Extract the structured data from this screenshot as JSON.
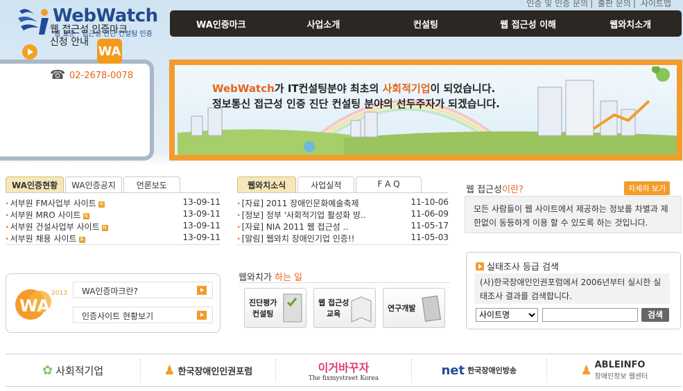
{
  "util": {
    "links": [
      "인증 및 인증 문의",
      "출판 문의",
      "사이트맵"
    ]
  },
  "logo": {
    "name": "WebWatch",
    "sub": "웹 표준 · 접근성 진단 컨설팅 인증"
  },
  "gnb": [
    "WA인증마크",
    "사업소개",
    "컨설팅",
    "웹 접근성 이해",
    "웹와치소개"
  ],
  "cert": {
    "line1": "웹 접근성 인증마크",
    "line2": "신청 안내",
    "mark": "WA",
    "phone": "02-2678-0078"
  },
  "banner": {
    "line1_a": "WebWatch",
    "line1_b": "가 IT컨설팅분야 최초의 ",
    "line1_c": "사회적기업",
    "line1_d": "이 되었습니다.",
    "line2": "정보통신 접근성 인증 진단 컨설팅 분야의 선두주자가 되겠습니다."
  },
  "panel1": {
    "tabs": [
      "WA인증현황",
      "WA인증공지",
      "언론보도"
    ],
    "items": [
      {
        "title": "서부원 FM사업부 사이트",
        "date": "13-09-11"
      },
      {
        "title": "서부원 MRO 사이트",
        "date": "13-09-11"
      },
      {
        "title": "서부원 건설사업부 사이트",
        "date": "13-09-11"
      },
      {
        "title": "서부원 채용 사이트",
        "date": "13-09-11"
      }
    ],
    "badge": "N"
  },
  "panel2": {
    "tabs": [
      "웹와치소식",
      "사업실적",
      "F A Q"
    ],
    "items": [
      {
        "title": "[자료] 2011 장애인문화예술축제",
        "date": "11-10-06"
      },
      {
        "title": "[정보] 정부 '사회적기업 활성화 방..",
        "date": "11-06-09"
      },
      {
        "title": "[자료] NIA 2011 웹 접근성 ..",
        "date": "11-05-17"
      },
      {
        "title": "[알림] 웹와치 장애인기업 인증!!",
        "date": "11-05-03"
      }
    ]
  },
  "acc": {
    "title_a": "웹 접근성",
    "title_b": "이란?",
    "more": "자세히 보기",
    "desc": "모든 사람들이 웹 사이트에서 제공하는 정보를 차별과 제한없이 동등하게 이용 할 수 있도록 하는 것입니다."
  },
  "wa2013": {
    "mark": "WA",
    "year": "2013",
    "btn1": "WA인증마크란?",
    "btn2": "인증사이트 현황보기"
  },
  "does": {
    "title_a": "웹와치가 ",
    "title_b": "하는 일",
    "boxes": [
      {
        "l1": "진단평가",
        "l2": "컨설팅"
      },
      {
        "l1": "웹 접근성",
        "l2": "교육"
      },
      {
        "l1": "연구개발",
        "l2": ""
      }
    ]
  },
  "search": {
    "title": "실태조사 등급 검색",
    "desc": "(사)한국장애인인권포럼에서 2006년부터 실시한 실태조사 결과를 검색합니다.",
    "select": "사이트명",
    "button": "검색"
  },
  "footer": [
    {
      "a": "사회적기업",
      "b": ""
    },
    {
      "a": "한국장애인인권포럼",
      "b": ""
    },
    {
      "a": "이거바꾸자",
      "b": "The fixmystreet Korea"
    },
    {
      "a": "net",
      "b": "한국장애인방송"
    },
    {
      "a": "ABLEINFO",
      "b": "장애인정보 웹센터"
    }
  ],
  "colors": {
    "accent": "#f39c2b",
    "nav": "#2b2723",
    "brand": "#224a8e"
  }
}
